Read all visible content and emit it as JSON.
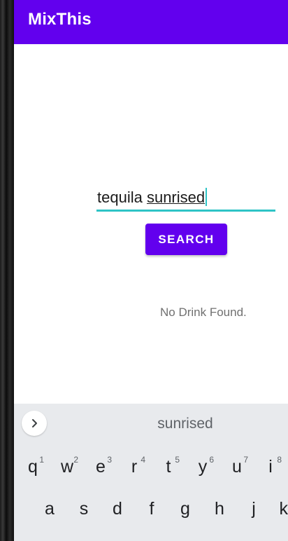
{
  "app": {
    "title": "MixThis"
  },
  "search": {
    "value_part1": "tequila ",
    "value_part2": "sunrised",
    "button_label": "SEARCH"
  },
  "result": {
    "status": "No Drink Found."
  },
  "keyboard": {
    "suggestion": "sunrised",
    "row1": [
      {
        "char": "q",
        "hint": "1"
      },
      {
        "char": "w",
        "hint": "2"
      },
      {
        "char": "e",
        "hint": "3"
      },
      {
        "char": "r",
        "hint": "4"
      },
      {
        "char": "t",
        "hint": "5"
      },
      {
        "char": "y",
        "hint": "6"
      },
      {
        "char": "u",
        "hint": "7"
      },
      {
        "char": "i",
        "hint": "8"
      }
    ],
    "row2": [
      "a",
      "s",
      "d",
      "f",
      "g",
      "h",
      "j",
      "k"
    ]
  },
  "colors": {
    "primary": "#6200ee",
    "accent": "#2ec4c6",
    "status_text": "#707070",
    "keyboard_bg": "#e8eaed"
  },
  "icons": {
    "expand": "chevron-right-icon"
  }
}
